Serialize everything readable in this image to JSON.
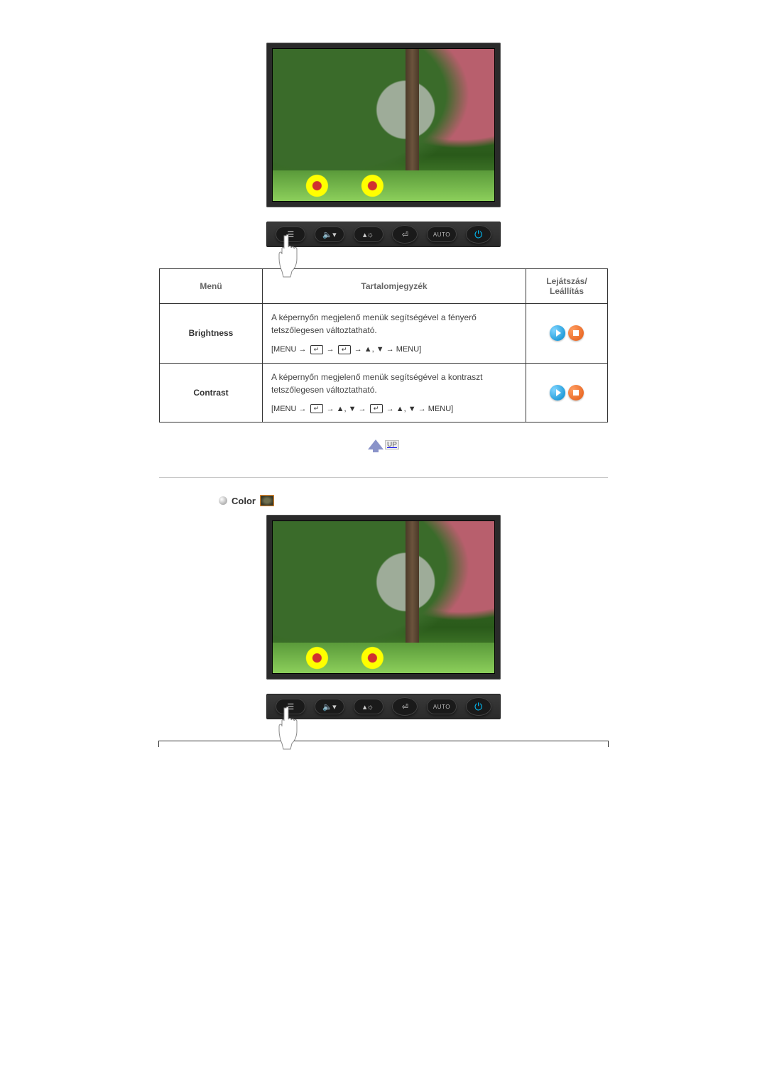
{
  "monitor_buttons": {
    "menu": "MENU",
    "auto": "AUTO"
  },
  "table": {
    "headers": {
      "menu": "Menü",
      "desc": "Tartalomjegyzék",
      "play": "Lejátszás/ Leállítás"
    },
    "rows": [
      {
        "name": "Brightness",
        "desc": "A képernyőn megjelenő menük segítségével a fényerő tetszőlegesen változtatható.",
        "path_prefix": "[MENU → ",
        "path_mid1": " → ",
        "path_mid2": " → ▲, ▼ → MENU]"
      },
      {
        "name": "Contrast",
        "desc": "A képernyőn megjelenő menük segítségével a kontraszt tetszőlegesen változtatható.",
        "path_prefix": "[MENU → ",
        "path_mid1": " → ▲, ▼ → ",
        "path_mid2": " → ▲, ▼ → MENU]"
      }
    ]
  },
  "up_label": "UP",
  "section2": {
    "title": "Color"
  },
  "enter_glyph": "↵"
}
